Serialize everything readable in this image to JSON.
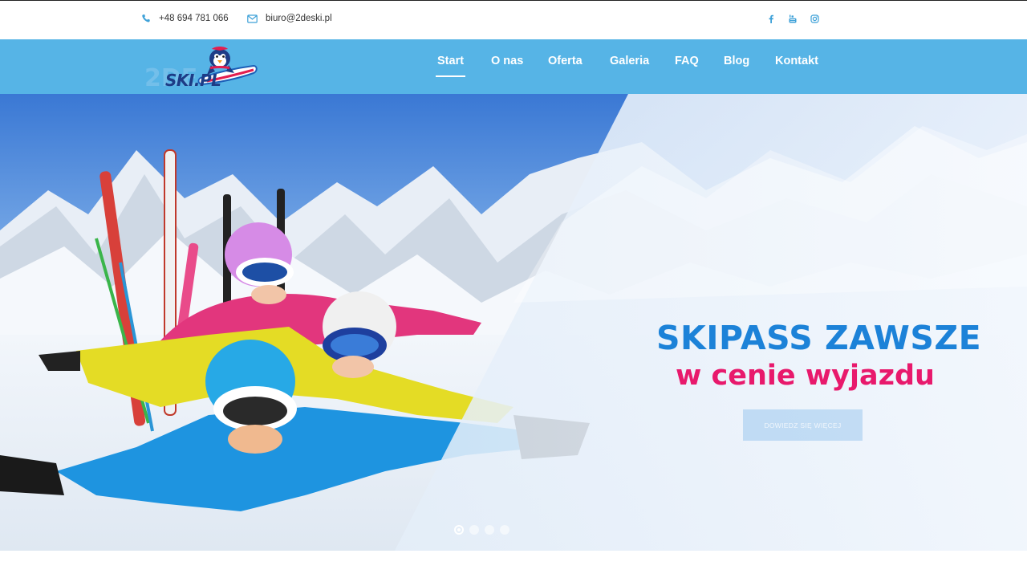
{
  "topbar": {
    "phone": "+48 694 781 066",
    "email": "biuro@2deski.pl",
    "icons": [
      "phone-icon",
      "mail-icon",
      "facebook-icon",
      "youtube-icon",
      "instagram-icon"
    ]
  },
  "brand": {
    "logo_text": "SKI.PL",
    "logo_prefix": "2DE",
    "colors": {
      "nav": "#56b4e6",
      "headline_blue": "#1c82d8",
      "headline_pink": "#e8196c"
    }
  },
  "nav": {
    "items": [
      {
        "label": "Start",
        "active": true
      },
      {
        "label": "O nas",
        "active": false
      },
      {
        "label": "Oferta",
        "active": false
      },
      {
        "label": "Galeria",
        "active": false
      },
      {
        "label": "FAQ",
        "active": false
      },
      {
        "label": "Blog",
        "active": false
      },
      {
        "label": "Kontakt",
        "active": false
      }
    ]
  },
  "hero": {
    "headline_line1": "SKIPASS ZAWSZE",
    "headline_line2": "w cenie wyjazdu",
    "cta_label": "DOWIEDZ SIĘ WIĘCEJ",
    "slides_total": 4,
    "active_slide": 1
  }
}
